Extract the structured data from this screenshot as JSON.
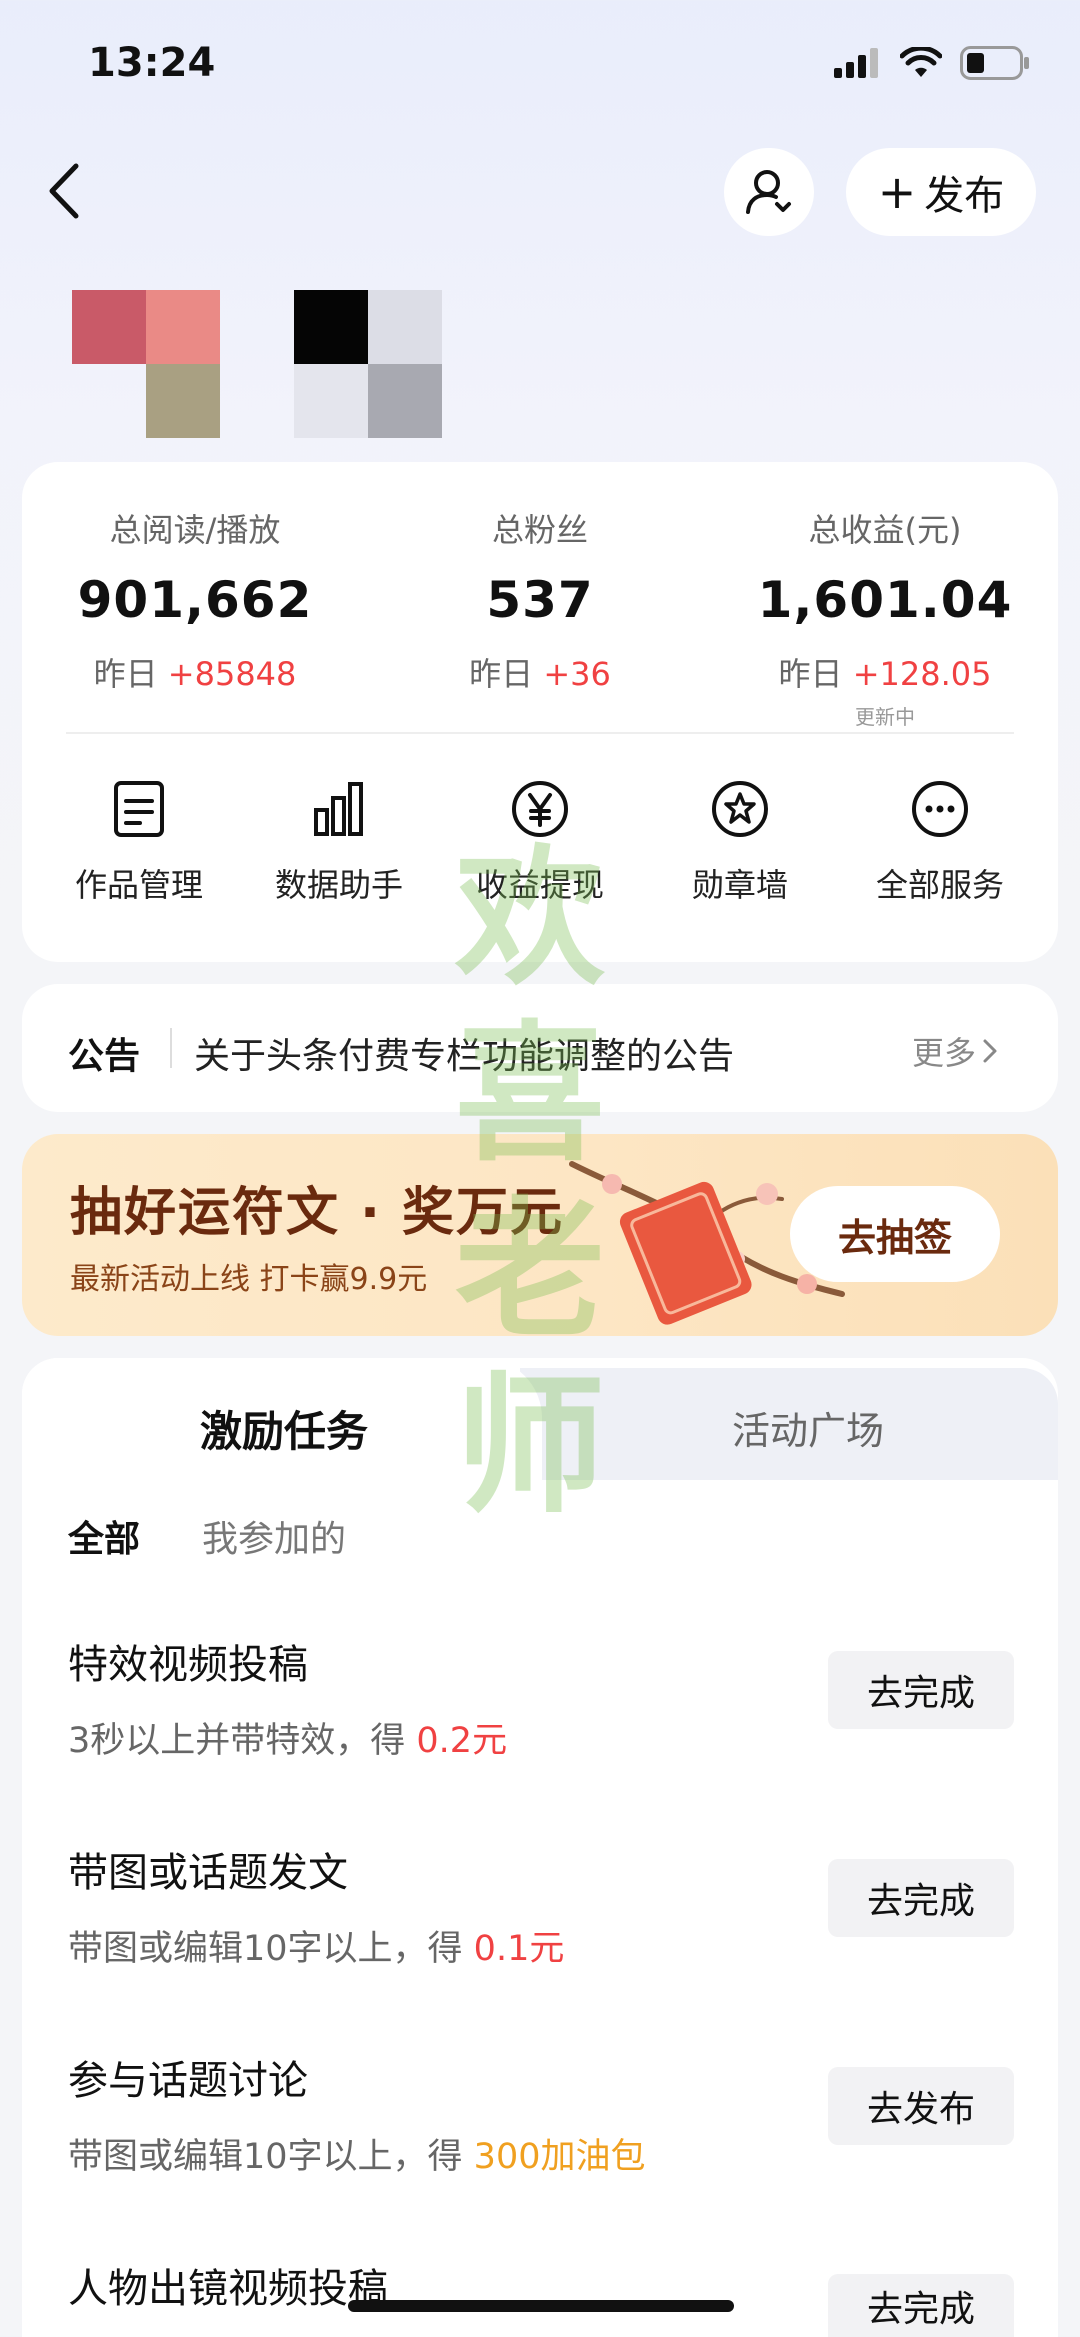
{
  "status_bar": {
    "time": "13:24"
  },
  "nav": {
    "publish_label": "发布"
  },
  "stats": [
    {
      "label": "总阅读/播放",
      "value": "901,662",
      "yday_prefix": "昨日",
      "delta": "+85848"
    },
    {
      "label": "总粉丝",
      "value": "537",
      "yday_prefix": "昨日",
      "delta": "+36"
    },
    {
      "label": "总收益(元)",
      "value": "1,601.04",
      "yday_prefix": "昨日",
      "delta": "+128.05",
      "note": "更新中"
    }
  ],
  "services": [
    {
      "label": "作品管理",
      "icon": "document-icon"
    },
    {
      "label": "数据助手",
      "icon": "bar-chart-icon"
    },
    {
      "label": "收益提现",
      "icon": "yen-icon"
    },
    {
      "label": "勋章墙",
      "icon": "medal-icon"
    },
    {
      "label": "全部服务",
      "icon": "more-icon"
    }
  ],
  "notice": {
    "tag": "公告",
    "text": "关于头条付费专栏功能调整的公告",
    "more": "更多"
  },
  "banner": {
    "title": "抽好运符文 · 奖万元",
    "subtitle": "最新活动上线 打卡赢9.9元",
    "button": "去抽签"
  },
  "tabs": {
    "active": "激励任务",
    "inactive": "活动广场"
  },
  "filters": {
    "all": "全部",
    "mine": "我参加的"
  },
  "tasks": [
    {
      "title": "特效视频投稿",
      "desc": "3秒以上并带特效，得 ",
      "reward": "0.2元",
      "button": "去完成"
    },
    {
      "title": "带图或话题发文",
      "desc": "带图或编辑10字以上，得 ",
      "reward": "0.1元",
      "button": "去完成"
    },
    {
      "title": "参与话题讨论",
      "desc": "带图或编辑10字以上，得 ",
      "reward": "300加油包",
      "button": "去发布"
    },
    {
      "title": "人物出镜视频投稿",
      "button": "去完成"
    }
  ],
  "watermark": "欢喜老师",
  "colors": {
    "accent_red": "#f04142",
    "accent_orange": "#f0a020",
    "banner_text": "#6a2a0e"
  }
}
